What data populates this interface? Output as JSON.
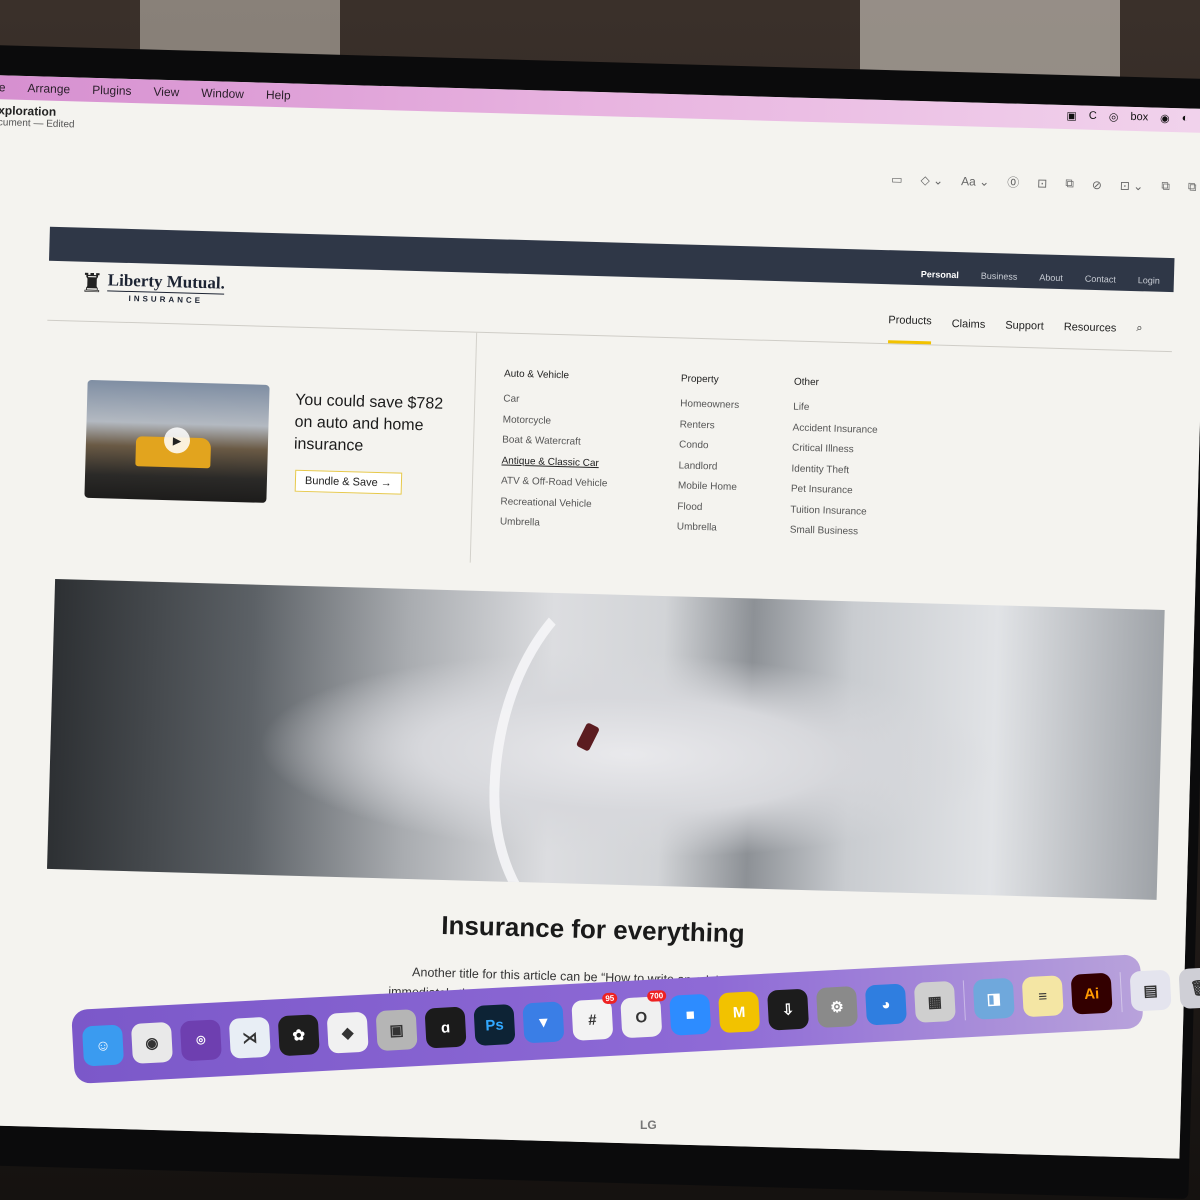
{
  "menubar": {
    "items": [
      "e",
      "Arrange",
      "Plugins",
      "View",
      "Window",
      "Help"
    ],
    "status_icons": [
      "zoom-icon",
      "c-icon",
      "target-icon",
      "box-icon",
      "record-icon",
      "globe-icon"
    ],
    "status_labels": [
      "▣",
      "C",
      "◎",
      "box",
      "◉",
      "◐"
    ]
  },
  "document": {
    "title": "xploration",
    "subtitle": "cument — Edited"
  },
  "toolbar": {
    "tools": [
      {
        "name": "present-icon",
        "glyph": "▭"
      },
      {
        "name": "component-icon",
        "glyph": "◇ ⌄"
      },
      {
        "name": "text-style-icon",
        "glyph": "Aa ⌄"
      },
      {
        "name": "variable-icon",
        "glyph": "⓪"
      },
      {
        "name": "crop-icon",
        "glyph": "⊡"
      },
      {
        "name": "arrange-icon",
        "glyph": "⧉"
      },
      {
        "name": "mask-icon",
        "glyph": "⊘"
      },
      {
        "name": "frame-icon",
        "glyph": "⊡ ⌄"
      },
      {
        "name": "boolean-union-icon",
        "glyph": "⧉"
      },
      {
        "name": "boolean-subtract-icon",
        "glyph": "⧉"
      }
    ]
  },
  "site": {
    "utility_nav": [
      {
        "label": "Personal",
        "active": true
      },
      {
        "label": "Business",
        "active": false
      },
      {
        "label": "About",
        "active": false
      },
      {
        "label": "Contact",
        "active": false
      },
      {
        "label": "Login",
        "active": false
      }
    ],
    "logo": {
      "name": "Liberty Mutual.",
      "sub": "INSURANCE"
    },
    "main_nav": [
      {
        "label": "Products",
        "active": true
      },
      {
        "label": "Claims",
        "active": false
      },
      {
        "label": "Support",
        "active": false
      },
      {
        "label": "Resources",
        "active": false
      }
    ],
    "accent_color": "#f2c200",
    "utility_bar_color": "#2f3747",
    "promo": {
      "headline": "You could save $782 on auto and home insurance",
      "button": "Bundle & Save →"
    },
    "mega_menu": [
      {
        "heading": "Auto & Vehicle",
        "items": [
          "Car",
          "Motorcycle",
          "Boat & Watercraft",
          "Antique & Classic Car",
          "ATV & Off-Road Vehicle",
          "Recreational Vehicle",
          "Umbrella"
        ]
      },
      {
        "heading": "Property",
        "items": [
          "Homeowners",
          "Renters",
          "Condo",
          "Landlord",
          "Mobile Home",
          "Flood",
          "Umbrella"
        ]
      },
      {
        "heading": "Other",
        "items": [
          "Life",
          "Accident Insurance",
          "Critical Illness",
          "Identity Theft",
          "Pet Insurance",
          "Tuition Insurance",
          "Small Business"
        ]
      }
    ],
    "hovered_item": "Antique & Classic Car",
    "article": {
      "title": "Insurance for everything",
      "body": "Another title for this article can be “How to write an ad that will be immediately thrown into a waste paper basket?”. But it is too long. In their business advertisers have to follow some rules to enhance the process of customer's perception of the presented information."
    }
  },
  "dock": {
    "apps": [
      {
        "name": "finder",
        "glyph": "☺",
        "color": "#3a9bf0"
      },
      {
        "name": "chrome",
        "glyph": "◉",
        "color": "#e9e9e9"
      },
      {
        "name": "github-desktop",
        "glyph": "⌾",
        "color": "#6e3fb0"
      },
      {
        "name": "vscode",
        "glyph": "⋊",
        "color": "#e8eef5"
      },
      {
        "name": "figma",
        "glyph": "✿",
        "color": "#1e1e1e"
      },
      {
        "name": "sketch",
        "glyph": "◆",
        "color": "#f1f1f1"
      },
      {
        "name": "preview-screenshot",
        "glyph": "▣",
        "color": "#b5b5b5"
      },
      {
        "name": "affinity",
        "glyph": "ɑ",
        "color": "#1b1b1b"
      },
      {
        "name": "photoshop",
        "glyph": "Ps",
        "color": "#0d2335"
      },
      {
        "name": "proton-vpn",
        "glyph": "▼",
        "color": "#3a7ee6"
      },
      {
        "name": "slack",
        "glyph": "#",
        "color": "#f3f3f3",
        "badge": "95"
      },
      {
        "name": "outlook",
        "glyph": "O",
        "color": "#f0f0f0",
        "badge": "700"
      },
      {
        "name": "zoom",
        "glyph": "■",
        "color": "#2d8cff"
      },
      {
        "name": "miro",
        "glyph": "M",
        "color": "#f2c200"
      },
      {
        "name": "installer",
        "glyph": "⇩",
        "color": "#1c1c1c"
      },
      {
        "name": "system-settings",
        "glyph": "⚙",
        "color": "#8a8a8a"
      },
      {
        "name": "migration",
        "glyph": "◕",
        "color": "#2f7ee0"
      },
      {
        "name": "calculator",
        "glyph": "▦",
        "color": "#cfcfcf"
      },
      {
        "name": "preview",
        "glyph": "◨",
        "color": "#6fa8dc"
      },
      {
        "name": "notes",
        "glyph": "≡",
        "color": "#f4e6a4"
      },
      {
        "name": "illustrator",
        "glyph": "Ai",
        "color": "#330000"
      },
      {
        "name": "recent-document",
        "glyph": "▤",
        "color": "#e4e4ee"
      },
      {
        "name": "trash",
        "glyph": "🗑",
        "color": "#cfcfd6"
      }
    ]
  },
  "monitor_brand": "LG"
}
